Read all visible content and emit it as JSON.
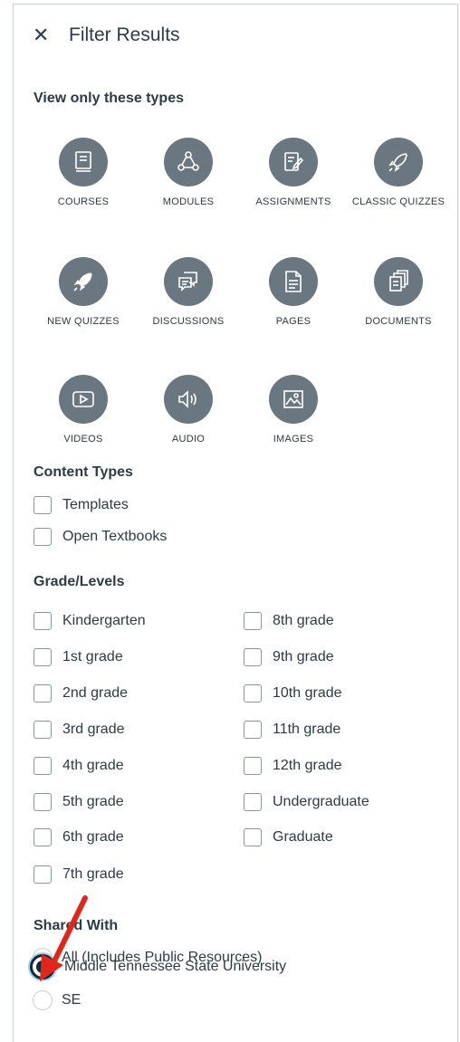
{
  "header": {
    "close_icon": "close-icon",
    "title": "Filter Results"
  },
  "types": {
    "title": "View only these types",
    "items": [
      {
        "name": "courses",
        "label": "COURSES",
        "icon": "course-icon"
      },
      {
        "name": "modules",
        "label": "MODULES",
        "icon": "modules-icon"
      },
      {
        "name": "assignments",
        "label": "ASSIGNMENTS",
        "icon": "assignment-icon"
      },
      {
        "name": "classic-quizzes",
        "label": "CLASSIC QUIZZES",
        "icon": "quiz-rocket-icon"
      },
      {
        "name": "new-quizzes",
        "label": "NEW QUIZZES",
        "icon": "new-quiz-rocket-icon"
      },
      {
        "name": "discussions",
        "label": "DISCUSSIONS",
        "icon": "discussion-icon"
      },
      {
        "name": "pages",
        "label": "PAGES",
        "icon": "page-icon"
      },
      {
        "name": "documents",
        "label": "DOCUMENTS",
        "icon": "documents-icon"
      },
      {
        "name": "videos",
        "label": "VIDEOS",
        "icon": "video-icon"
      },
      {
        "name": "audio",
        "label": "AUDIO",
        "icon": "audio-icon"
      },
      {
        "name": "images",
        "label": "IMAGES",
        "icon": "image-icon"
      }
    ]
  },
  "content_types": {
    "title": "Content Types",
    "items": [
      "Templates",
      "Open Textbooks"
    ]
  },
  "grade_levels": {
    "title": "Grade/Levels",
    "left": [
      "Kindergarten",
      "1st grade",
      "2nd grade",
      "3rd grade",
      "4th grade",
      "5th grade",
      "6th grade",
      "7th grade"
    ],
    "right": [
      "8th grade",
      "9th grade",
      "10th grade",
      "11th grade",
      "12th grade",
      "Undergraduate",
      "Graduate"
    ]
  },
  "shared_with": {
    "title": "Shared With",
    "options": [
      "All (Includes Public Resources)",
      "Middle Tennessee State University",
      "SE"
    ],
    "selected": "Middle Tennessee State University"
  },
  "colors": {
    "icon_bg": "#6b7780",
    "text": "#2d3b45",
    "annotation_arrow": "#e0261b",
    "radio_selected": "#0b2a3a"
  }
}
